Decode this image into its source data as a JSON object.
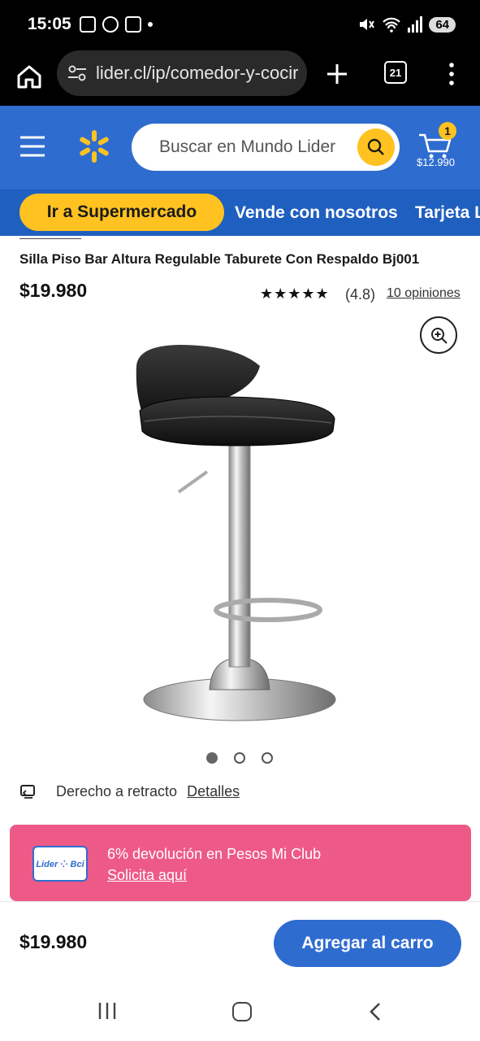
{
  "status_bar": {
    "time": "15:05",
    "battery": "64",
    "icons": [
      "photo-icon",
      "pinwheel-icon",
      "screenshot-icon",
      "notification-dot",
      "mute-icon",
      "wifi-icon",
      "signal-icon",
      "battery-icon"
    ]
  },
  "browser": {
    "url": "lider.cl/ip/comedor-y-cocir",
    "tab_count": "21"
  },
  "header": {
    "search_placeholder": "Buscar en Mundo Lider",
    "cart_count": "1",
    "cart_total": "$12.990",
    "brand_color": "#2f6ccf",
    "accent_color": "#ffc220"
  },
  "nav": {
    "supermarket": "Ir a Supermercado",
    "sell": "Vende con nosotros",
    "card": "Tarjeta L"
  },
  "product": {
    "title": "Silla Piso Bar Altura Regulable Taburete Con Respaldo Bj001",
    "price": "$19.980",
    "stars": "★★★★★",
    "rating": "(4.8)",
    "reviews": "10 opiniones",
    "image_count": 3,
    "active_image": 1
  },
  "return_policy": {
    "text": "Derecho a retracto",
    "link": "Detalles"
  },
  "promo": {
    "logo_text": "Lider ⁘ Bci",
    "text": "6% devolución en Pesos Mi Club",
    "link": "Solicita aquí",
    "color": "#ee5a87"
  },
  "footer": {
    "price": "$19.980",
    "add_to_cart": "Agregar al carro"
  }
}
